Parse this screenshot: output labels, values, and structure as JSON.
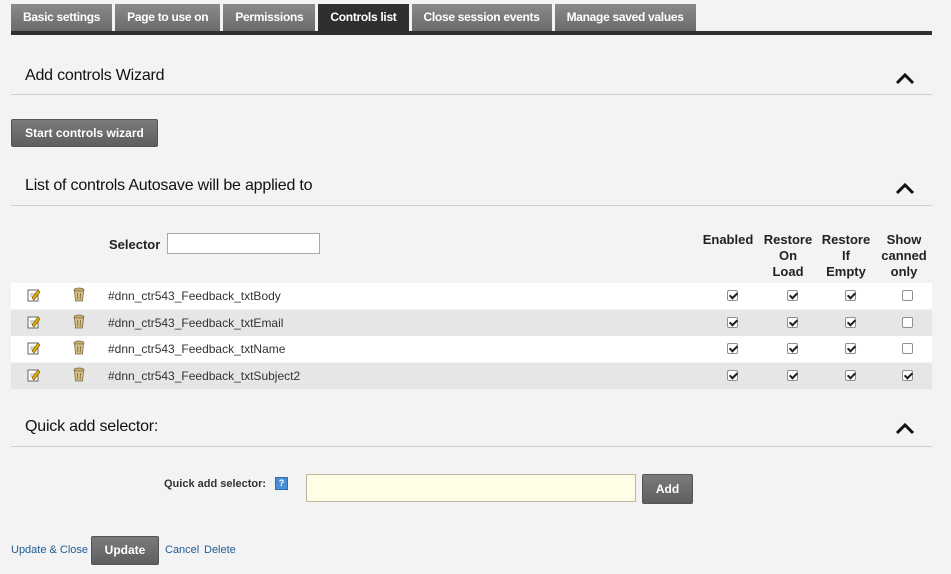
{
  "tabs": [
    {
      "label": "Basic settings",
      "active": false
    },
    {
      "label": "Page to use on",
      "active": false
    },
    {
      "label": "Permissions",
      "active": false
    },
    {
      "label": "Controls list",
      "active": true
    },
    {
      "label": "Close session events",
      "active": false
    },
    {
      "label": "Manage saved values",
      "active": false
    }
  ],
  "wizard": {
    "title": "Add controls Wizard",
    "button": "Start controls wizard"
  },
  "controls": {
    "title": "List of controls Autosave will be applied to",
    "selector_label": "Selector",
    "selector_value": "",
    "columns": {
      "enabled": "Enabled",
      "restore_on_load": [
        "Restore",
        "On",
        "Load"
      ],
      "restore_if_empty": [
        "Restore",
        "If",
        "Empty"
      ],
      "show_canned": [
        "Show",
        "canned",
        "only"
      ]
    },
    "rows": [
      {
        "selector": "#dnn_ctr543_Feedback_txtBody",
        "enabled": true,
        "restore_on_load": true,
        "restore_if_empty": true,
        "show_canned": false
      },
      {
        "selector": "#dnn_ctr543_Feedback_txtEmail",
        "enabled": true,
        "restore_on_load": true,
        "restore_if_empty": true,
        "show_canned": false
      },
      {
        "selector": "#dnn_ctr543_Feedback_txtName",
        "enabled": true,
        "restore_on_load": true,
        "restore_if_empty": true,
        "show_canned": false
      },
      {
        "selector": "#dnn_ctr543_Feedback_txtSubject2",
        "enabled": true,
        "restore_on_load": true,
        "restore_if_empty": true,
        "show_canned": true
      }
    ]
  },
  "quick_add": {
    "title": "Quick add selector:",
    "label": "Quick add selector:",
    "help_glyph": "?",
    "value": "",
    "add_button": "Add"
  },
  "footer": {
    "update_close": "Update & Close",
    "update": "Update",
    "cancel": "Cancel",
    "delete": "Delete"
  },
  "icons": {
    "edit": "pencil-edit-icon",
    "delete": "trash-bin-icon",
    "collapse": "chevron-up-icon",
    "help": "help-icon"
  }
}
